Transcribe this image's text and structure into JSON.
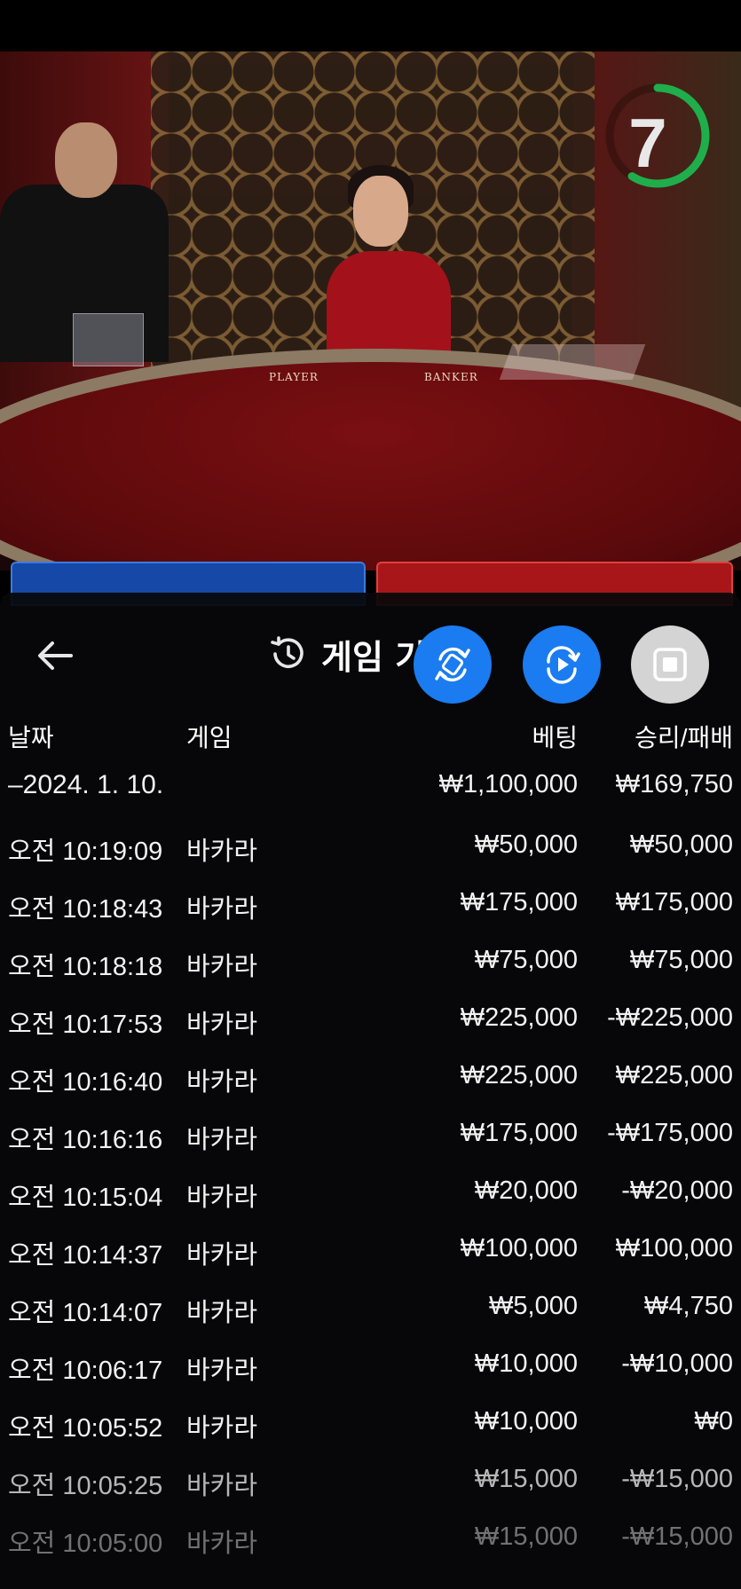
{
  "timer": {
    "seconds": "7",
    "ring_color": "#1fae4b"
  },
  "table": {
    "player_label": "PLAYER",
    "banker_label": "BANKER"
  },
  "header": {
    "back_icon": "arrow-left-icon",
    "history_icon": "history-clock-icon",
    "title": "게임 기록"
  },
  "fabs": {
    "swap_icon": "swap-table-icon",
    "replay_icon": "replay-video-icon",
    "stop_icon": "stop-icon",
    "accent": "#1a7cf0"
  },
  "history": {
    "columns": {
      "date": "날짜",
      "game": "게임",
      "bet": "베팅",
      "win_loss": "승리/패배"
    },
    "date_group": {
      "date": "–2024. 1. 10.",
      "bet_total": "₩1,100,000",
      "win_total": "₩169,750"
    },
    "rows": [
      {
        "time": "오전 10:19:09",
        "game": "바카라",
        "bet": "₩50,000",
        "result": "₩50,000"
      },
      {
        "time": "오전 10:18:43",
        "game": "바카라",
        "bet": "₩175,000",
        "result": "₩175,000"
      },
      {
        "time": "오전 10:18:18",
        "game": "바카라",
        "bet": "₩75,000",
        "result": "₩75,000"
      },
      {
        "time": "오전 10:17:53",
        "game": "바카라",
        "bet": "₩225,000",
        "result": "-₩225,000"
      },
      {
        "time": "오전 10:16:40",
        "game": "바카라",
        "bet": "₩225,000",
        "result": "₩225,000"
      },
      {
        "time": "오전 10:16:16",
        "game": "바카라",
        "bet": "₩175,000",
        "result": "-₩175,000"
      },
      {
        "time": "오전 10:15:04",
        "game": "바카라",
        "bet": "₩20,000",
        "result": "-₩20,000"
      },
      {
        "time": "오전 10:14:37",
        "game": "바카라",
        "bet": "₩100,000",
        "result": "₩100,000"
      },
      {
        "time": "오전 10:14:07",
        "game": "바카라",
        "bet": "₩5,000",
        "result": "₩4,750"
      },
      {
        "time": "오전 10:06:17",
        "game": "바카라",
        "bet": "₩10,000",
        "result": "-₩10,000"
      },
      {
        "time": "오전 10:05:52",
        "game": "바카라",
        "bet": "₩10,000",
        "result": "₩0"
      },
      {
        "time": "오전 10:05:25",
        "game": "바카라",
        "bet": "₩15,000",
        "result": "-₩15,000"
      },
      {
        "time": "오전 10:05:00",
        "game": "바카라",
        "bet": "₩15,000",
        "result": "-₩15,000"
      }
    ]
  }
}
